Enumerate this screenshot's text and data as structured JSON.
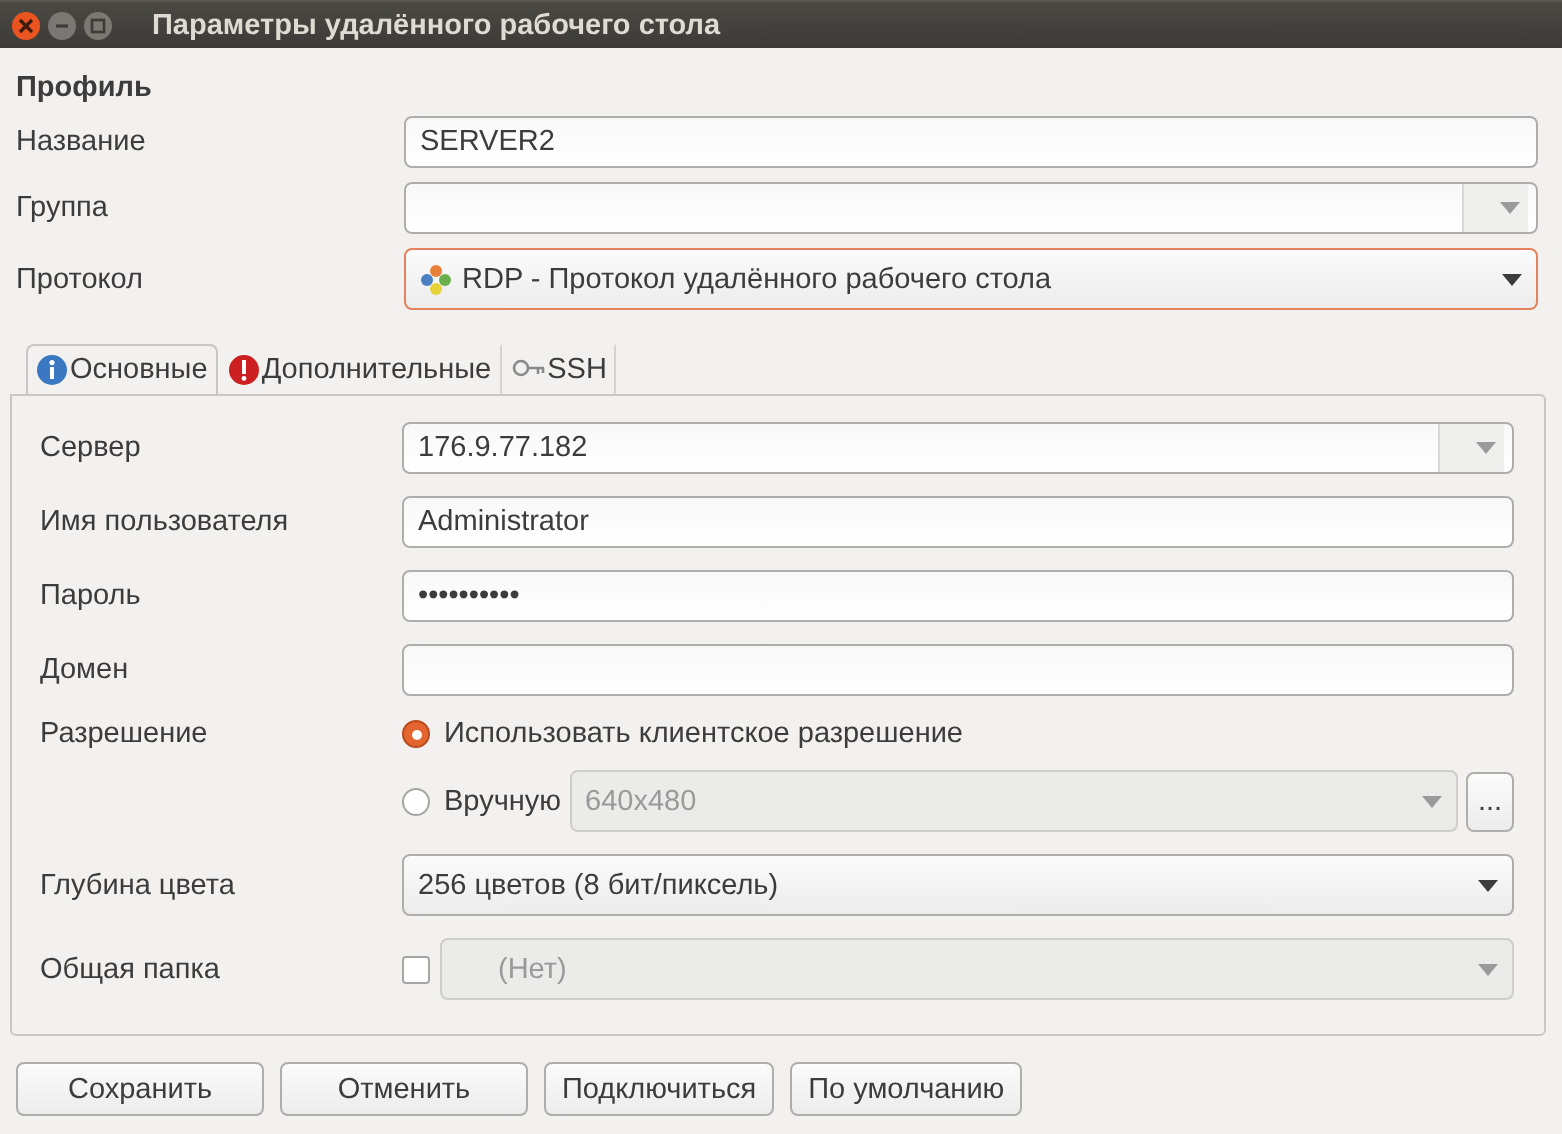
{
  "window": {
    "title": "Параметры удалённого рабочего стола"
  },
  "profile": {
    "heading": "Профиль",
    "fields": [
      {
        "label": "Название",
        "kind": "entry",
        "value": "SERVER2"
      },
      {
        "label": "Группа",
        "kind": "combo_entry"
      },
      {
        "label": "Протокол",
        "kind": "combo",
        "value": "RDP - Протокол удалённого рабочего стола",
        "focused": true
      }
    ]
  },
  "tabs": [
    {
      "label": "Основные",
      "selected": true
    },
    {
      "label": "Дополнительные",
      "selected": false
    },
    {
      "label": "SSH",
      "selected": false
    }
  ],
  "basic": [
    {
      "label": "Сервер",
      "kind": "combo_entry",
      "value": "176.9.77.182"
    },
    {
      "label": "Имя пользователя",
      "kind": "entry",
      "value": "Administrator"
    },
    {
      "label": "Пароль",
      "kind": "entry",
      "value": "••••••••••"
    },
    {
      "label": "Домен",
      "kind": "entry"
    },
    {
      "label": "Разрешение",
      "kind": "resolution",
      "options": [
        {
          "label": "Использовать клиентское разрешение",
          "selected": true
        },
        {
          "label": "Вручную",
          "selected": false,
          "value": "640x480",
          "button": "..."
        }
      ]
    },
    {
      "label": "Глубина цвета",
      "kind": "combo",
      "value": "256 цветов (8 бит/пиксель)"
    },
    {
      "label": "Общая папка",
      "kind": "check_combo",
      "checked": false,
      "value": "(Нет)"
    }
  ],
  "buttons": [
    "Сохранить",
    "Отменить",
    "Подключиться",
    "По умолчанию"
  ]
}
